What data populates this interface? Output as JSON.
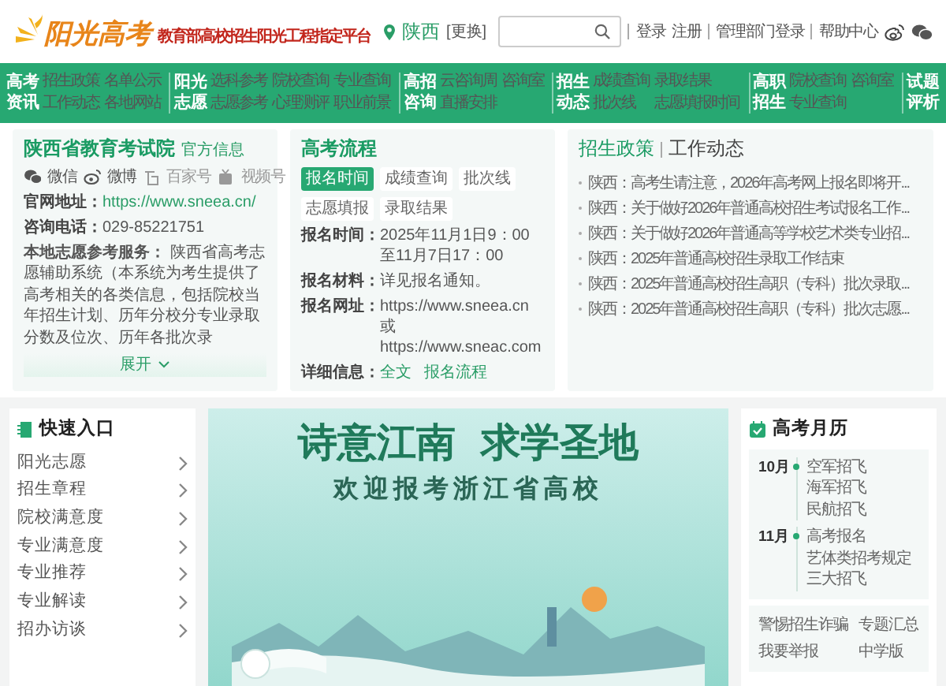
{
  "header": {
    "logo_title": "阳光高考",
    "logo_subtitle": "教育部高校招生阳光工程指定平台",
    "location": "陕西",
    "location_change": "[更换]",
    "links": [
      "登录",
      "注册",
      "管理部门登录",
      "帮助中心"
    ]
  },
  "nav": [
    {
      "title": "高考资讯",
      "links": [
        "招生政策",
        "名单公示",
        "工作动态",
        "各地网站"
      ]
    },
    {
      "title": "阳光志愿",
      "links": [
        "选科参考",
        "院校查询",
        "专业查询",
        "志愿参考",
        "心理测评",
        "职业前景"
      ]
    },
    {
      "title": "高招咨询",
      "links": [
        "云咨询周",
        "咨询室",
        "直播安排"
      ]
    },
    {
      "title": "招生动态",
      "links": [
        "成绩查询",
        "录取结果",
        "批次线",
        "志愿填报时间"
      ]
    },
    {
      "title": "高职招生",
      "links": [
        "院校查询",
        "咨询室",
        "专业查询"
      ]
    },
    {
      "title": "试题评析"
    }
  ],
  "exam_office": {
    "title": "陕西省教育考试院",
    "badge": "官方信息",
    "socials": [
      {
        "kind": "wechat",
        "label": "微信"
      },
      {
        "kind": "weibo",
        "label": "微博"
      },
      {
        "kind": "baijia",
        "label": "百家号"
      },
      {
        "kind": "video",
        "label": "视频号"
      }
    ],
    "fields": [
      {
        "label": "官网地址：",
        "value": "https://www.sneea.cn/",
        "kind": "link"
      },
      {
        "label": "咨询电话：",
        "value": "029-85221751",
        "kind": "text"
      }
    ],
    "service": "**本地志愿参考服务：** 陕西省高考志愿辅助系统（本系统为考生提供了高考相关的各类信息，包括院校当年招生计划、历年分校分专业录取分数及位次、历年各批次录",
    "expand": "展开"
  },
  "process": {
    "title": "高考流程",
    "tabs": [
      {
        "label": "报名时间",
        "selected": true
      },
      {
        "label": "成绩查询",
        "selected": false
      },
      {
        "label": "批次线",
        "selected": false
      },
      {
        "label": "志愿填报",
        "selected": false
      },
      {
        "label": "录取结果",
        "selected": false
      }
    ],
    "rows": [
      {
        "label": "报名时间：",
        "kind": "text",
        "values": [
          "2025年11月1日9：00至11月7日17：00"
        ]
      },
      {
        "label": "报名材料：",
        "kind": "text",
        "values": [
          "详见报名通知。"
        ]
      },
      {
        "label": "报名网址：",
        "kind": "text",
        "values": [
          "https://www.sneea.cn 或",
          "https://www.sneac.com"
        ]
      },
      {
        "label": "详细信息：",
        "kind": "link",
        "values": [
          "全文",
          "报名流程"
        ]
      }
    ]
  },
  "policy": {
    "tabs": [
      {
        "label": "招生政策",
        "selected": true
      },
      {
        "label": "工作动态",
        "selected": false
      }
    ],
    "items": [
      "陕西：高考生请注意，2026年高考网上报名即将开...",
      "陕西：关于做好2026年普通高校招生考试报名工作...",
      "陕西：关于做好2026年普通高等学校艺术类专业招...",
      "陕西：2025年普通高校招生录取工作结束",
      "陕西：2025年普通高校招生高职（专科）批次录取...",
      "陕西：2025年普通高校招生高职（专科）批次志愿..."
    ]
  },
  "quick_entry": {
    "title": "快速入口",
    "items": [
      "阳光志愿",
      "招生章程",
      "院校满意度",
      "专业满意度",
      "专业推荐",
      "专业解读",
      "招办访谈"
    ]
  },
  "banner": {
    "headline": [
      "诗意江南",
      "求学圣地"
    ],
    "subtitle": "欢迎报考浙江省高校"
  },
  "calendar": {
    "title": "高考月历",
    "months": [
      {
        "month": "10月",
        "events": [
          "空军招飞",
          "海军招飞",
          "民航招飞"
        ]
      },
      {
        "month": "11月",
        "events": [
          "高考报名",
          "艺体类招考规定",
          "三大招飞"
        ]
      }
    ],
    "links": [
      "警惕招生诈骗",
      "专题汇总",
      "我要举报",
      "中学版"
    ]
  }
}
